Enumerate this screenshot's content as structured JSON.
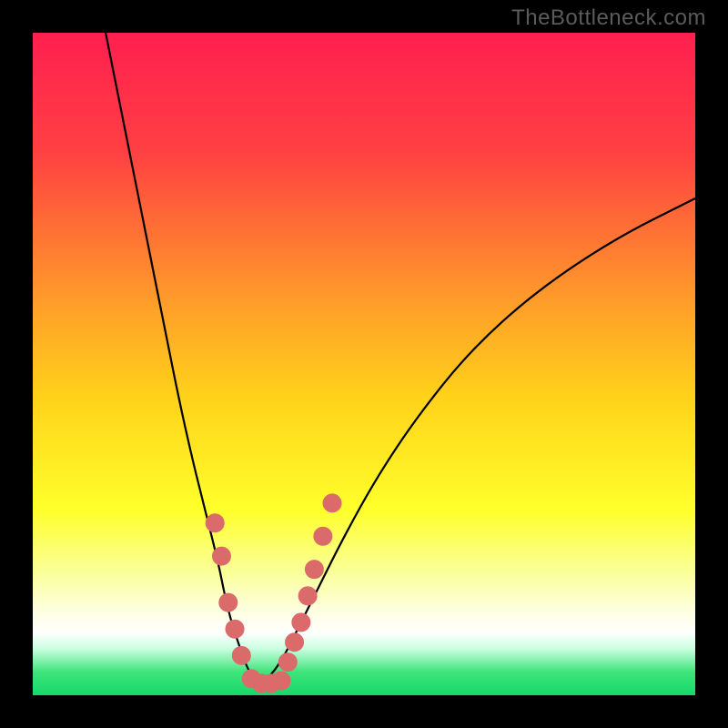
{
  "watermark": "TheBottleneck.com",
  "colors": {
    "dot": "#db6b6b",
    "curve": "#000000",
    "frame": "#000000"
  },
  "gradient_stops": [
    {
      "offset": 0.0,
      "color": "#ff1f4f"
    },
    {
      "offset": 0.18,
      "color": "#ff4042"
    },
    {
      "offset": 0.4,
      "color": "#ff9a2a"
    },
    {
      "offset": 0.55,
      "color": "#ffd21a"
    },
    {
      "offset": 0.72,
      "color": "#ffff2a"
    },
    {
      "offset": 0.82,
      "color": "#faffa0"
    },
    {
      "offset": 0.88,
      "color": "#ffffe8"
    },
    {
      "offset": 0.905,
      "color": "#ffffff"
    },
    {
      "offset": 0.93,
      "color": "#c9ffe0"
    },
    {
      "offset": 0.965,
      "color": "#3fe47a"
    },
    {
      "offset": 1.0,
      "color": "#15d86a"
    }
  ],
  "chart_data": {
    "type": "line",
    "title": "",
    "xlabel": "",
    "ylabel": "",
    "xlim": [
      0,
      100
    ],
    "ylim": [
      0,
      100
    ],
    "series": [
      {
        "name": "left-curve",
        "x": [
          11,
          14,
          17,
          20,
          22,
          24,
          26,
          28,
          29,
          30,
          31,
          32,
          33,
          34
        ],
        "y": [
          100,
          85,
          70,
          55,
          45,
          36,
          28,
          20,
          15,
          11,
          8,
          5,
          3,
          1.5
        ]
      },
      {
        "name": "right-curve",
        "x": [
          34,
          36,
          38,
          40,
          43,
          47,
          52,
          58,
          66,
          76,
          88,
          100
        ],
        "y": [
          1.5,
          3,
          6,
          10,
          16,
          24,
          33,
          42,
          52,
          61,
          69,
          75
        ]
      }
    ],
    "valley_dots": {
      "name": "highlight-dots",
      "points": [
        {
          "x": 27.5,
          "y": 26
        },
        {
          "x": 28.5,
          "y": 21
        },
        {
          "x": 29.5,
          "y": 14
        },
        {
          "x": 30.5,
          "y": 10
        },
        {
          "x": 31.5,
          "y": 6
        },
        {
          "x": 33.0,
          "y": 2.5
        },
        {
          "x": 34.5,
          "y": 1.8
        },
        {
          "x": 36.0,
          "y": 1.8
        },
        {
          "x": 37.5,
          "y": 2.2
        },
        {
          "x": 38.5,
          "y": 5
        },
        {
          "x": 39.5,
          "y": 8
        },
        {
          "x": 40.5,
          "y": 11
        },
        {
          "x": 41.5,
          "y": 15
        },
        {
          "x": 42.5,
          "y": 19
        },
        {
          "x": 43.8,
          "y": 24
        },
        {
          "x": 45.2,
          "y": 29
        }
      ]
    }
  }
}
